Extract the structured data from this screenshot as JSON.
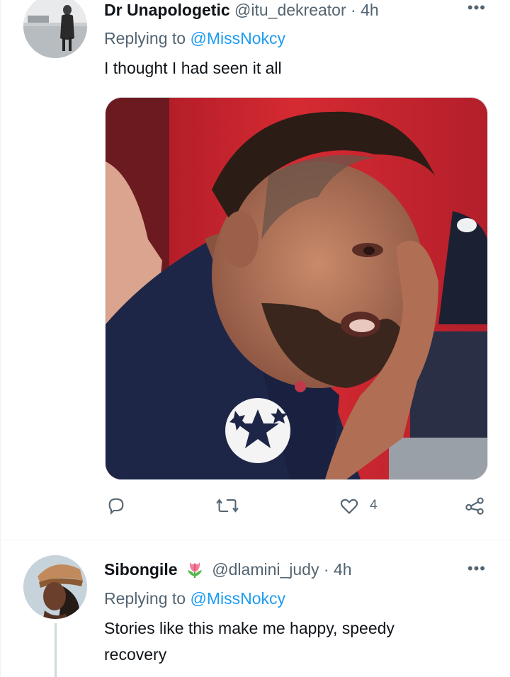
{
  "tweets": [
    {
      "display_name": "Dr Unapologetic",
      "handle": "@itu_dekreator",
      "time": "4h",
      "replying_prefix": "Replying to",
      "replying_to": "@MissNokcy",
      "text": "I thought I had seen it all",
      "has_media": true,
      "actions": {
        "replies": "",
        "retweets": "",
        "likes": "4"
      }
    },
    {
      "display_name": "Sibongile",
      "name_emoji": "tulip",
      "handle": "@dlamini_judy",
      "time": "4h",
      "replying_prefix": "Replying to",
      "replying_to": "@MissNokcy",
      "text_line1": "Stories like this make me happy, speedy",
      "text_line2": "recovery"
    }
  ],
  "icons": {
    "more": "more-horizontal-icon",
    "reply": "reply-icon",
    "retweet": "retweet-icon",
    "like": "heart-icon",
    "share": "share-icon"
  },
  "colors": {
    "link": "#1d9bf0",
    "muted": "#536471",
    "text": "#0f1419"
  }
}
